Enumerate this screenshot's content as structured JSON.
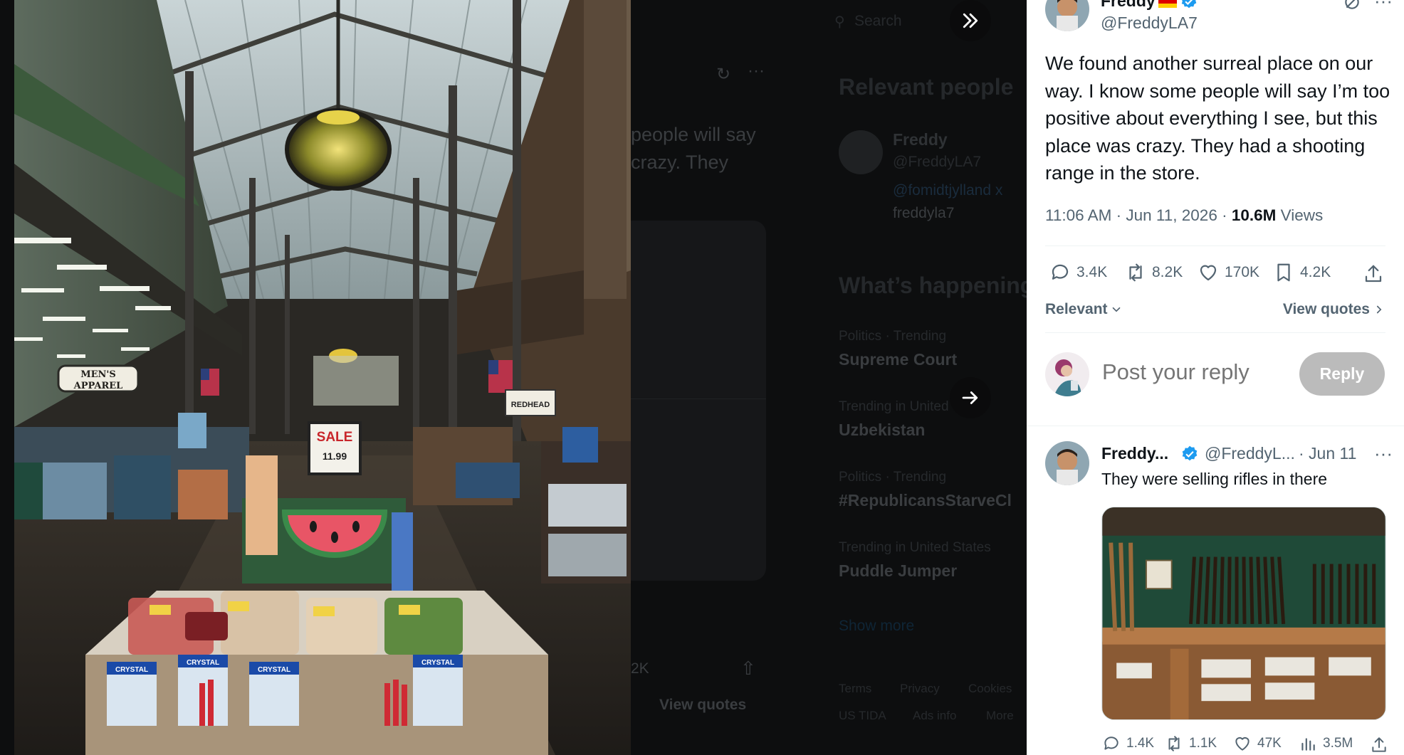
{
  "background": {
    "search_placeholder": "Search",
    "tweet_fragment": [
      "people will say",
      "crazy. They"
    ],
    "relevant_people_heading": "Relevant people",
    "person": {
      "name": "Freddy",
      "handle": "@FreddyLA7",
      "bio": [
        "@fomidtjylland x",
        "freddyla7"
      ]
    },
    "whats_happening_heading": "What’s happening",
    "trends": [
      {
        "context": "Politics · Trending",
        "title": "Supreme Court"
      },
      {
        "context": "Trending in United S",
        "title": "Uzbekistan"
      },
      {
        "context": "Politics · Trending",
        "title": "#RepublicansStarveCl"
      },
      {
        "context": "Trending in United States",
        "title": "Puddle Jumper"
      }
    ],
    "show_more": "Show more",
    "count_fragment": "2K",
    "view_quotes_fragment": "View quotes",
    "footer_links": [
      "Terms",
      "Privacy",
      "Cookies",
      "US TIDA",
      "Ads info",
      "More"
    ]
  },
  "media": {
    "nav_collapse_icon": "double-chevron-right-icon",
    "nav_next_icon": "arrow-right-icon",
    "sign_mens_apparel": [
      "MEN'S",
      "APPAREL"
    ],
    "sign_sale": [
      "SALE",
      "11.99"
    ],
    "sign_redhead": "REDHEAD",
    "sign_crystal": "CRYSTAL"
  },
  "tweet": {
    "display_name": "Freddy",
    "handle": "@FreddyLA7",
    "text": "We found another surreal place on our way. I know some people will say I’m too positive about everything I see, but this place was crazy. They had a shooting range in the store.",
    "time": "11:06 AM · Jun 11, 2026 · ",
    "views_count": "10.6M",
    "views_label": " Views",
    "stats": {
      "replies": "3.4K",
      "retweets": "8.2K",
      "likes": "170K",
      "bookmarks": "4.2K"
    },
    "sort_label": "Relevant",
    "view_quotes_label": "View quotes"
  },
  "composer": {
    "placeholder": "Post your reply",
    "button_label": "Reply"
  },
  "reply": {
    "display_name": "Freddy...",
    "handle": "@FreddyL...",
    "date": "· Jun 11",
    "text": "They were selling rifles in there",
    "stats": {
      "replies": "1.4K",
      "retweets": "1.1K",
      "likes": "47K",
      "views": "3.5M"
    }
  },
  "colors": {
    "accent_blue": "#1d9bf0",
    "text_primary": "#0f1419",
    "text_secondary": "#536471",
    "reply_button_disabled": "#bbbbbb"
  }
}
